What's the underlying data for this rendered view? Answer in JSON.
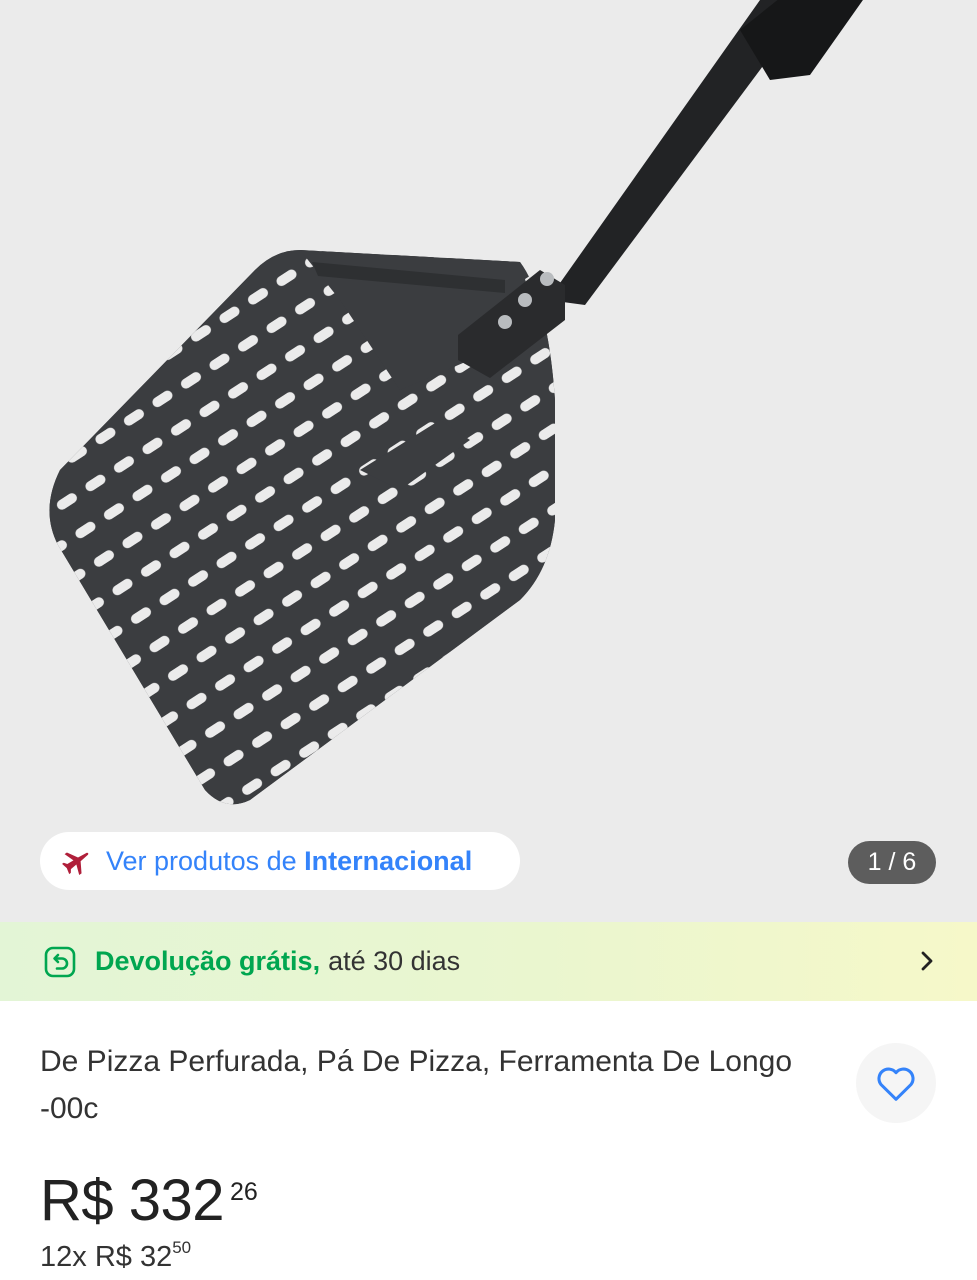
{
  "gallery": {
    "image_alt": "Pá de pizza perfurada preta com cabo longo",
    "counter": "1 / 6"
  },
  "seller_link": {
    "icon": "airplane-icon",
    "prefix": "Ver produtos de",
    "store": "Internacional"
  },
  "returns": {
    "icon": "return-icon",
    "strong": "Devolução grátis,",
    "rest": "até 30 dias"
  },
  "product": {
    "title": "De Pizza Perfurada, Pá De Pizza, Ferramenta De Longo -00c",
    "price_main": "R$ 332",
    "price_cents": "26",
    "installments_main": "12x R$ 32",
    "installments_cents": "50"
  },
  "colors": {
    "accent": "#3483fa",
    "success": "#00a650",
    "plane": "#b01f3a"
  }
}
